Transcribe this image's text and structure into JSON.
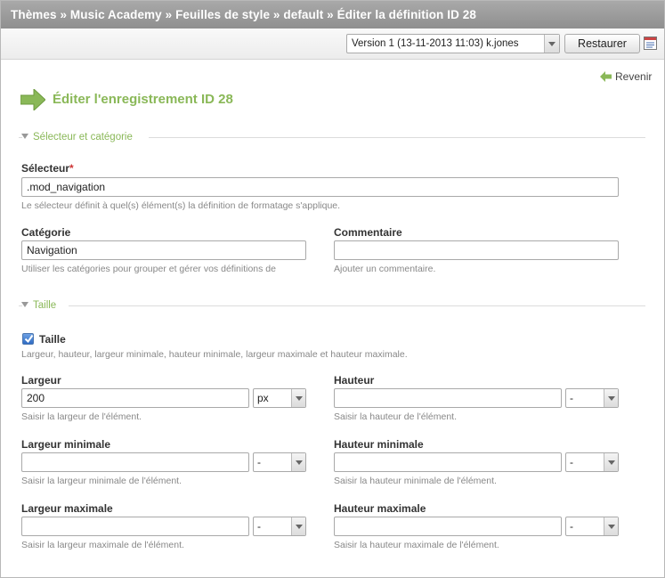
{
  "breadcrumb": "Thèmes » Music Academy » Feuilles de style » default » Éditer la définition ID 28",
  "version_bar": {
    "version_value": "Version 1 (13-11-2013 11:03) k.jones",
    "restore_label": "Restaurer",
    "diff_icon": "diff-compare-icon"
  },
  "back_label": "Revenir",
  "page_title": "Éditer l'enregistrement ID 28",
  "sections": {
    "selector": {
      "legend": "Sélecteur et catégorie",
      "selector_label": "Sélecteur",
      "required_mark": "*",
      "selector_value": ".mod_navigation",
      "selector_help": "Le sélecteur définit à quel(s) élément(s) la définition de formatage s'applique.",
      "category_label": "Catégorie",
      "category_value": "Navigation",
      "category_help": "Utiliser les catégories pour grouper et gérer vos définitions de",
      "comment_label": "Commentaire",
      "comment_value": "",
      "comment_help": "Ajouter un commentaire."
    },
    "size": {
      "legend": "Taille",
      "checkbox_label": "Taille",
      "checkbox_checked": true,
      "checkbox_help": "Largeur, hauteur, largeur minimale, hauteur minimale, largeur maximale et hauteur maximale.",
      "width_label": "Largeur",
      "width_value": "200",
      "width_unit": "px",
      "width_help": "Saisir la largeur de l'élément.",
      "height_label": "Hauteur",
      "height_value": "",
      "height_unit": "-",
      "height_help": "Saisir la hauteur de l'élément.",
      "minwidth_label": "Largeur minimale",
      "minwidth_value": "",
      "minwidth_unit": "-",
      "minwidth_help": "Saisir la largeur minimale de l'élément.",
      "minheight_label": "Hauteur minimale",
      "minheight_value": "",
      "minheight_unit": "-",
      "minheight_help": "Saisir la hauteur minimale de l'élément.",
      "maxwidth_label": "Largeur maximale",
      "maxwidth_value": "",
      "maxwidth_unit": "-",
      "maxwidth_help": "Saisir la largeur maximale de l'élément.",
      "maxheight_label": "Hauteur maximale",
      "maxheight_value": "",
      "maxheight_unit": "-",
      "maxheight_help": "Saisir la hauteur maximale de l'élément."
    }
  },
  "colors": {
    "accent_green": "#8ab858",
    "header_gray": "#9a9a9a",
    "required_red": "#cc3333"
  }
}
